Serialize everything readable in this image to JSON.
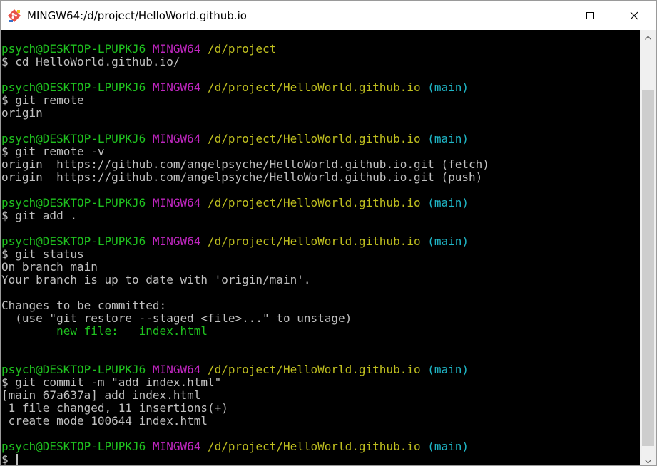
{
  "window": {
    "title": "MINGW64:/d/project/HelloWorld.github.io",
    "icons": {
      "app": "git-bash-icon",
      "minimize": "minimize-icon",
      "maximize": "maximize-icon",
      "close": "close-icon"
    }
  },
  "terminal": {
    "colors": {
      "background": "#000000",
      "text": "#c0c0c0",
      "user_host": "#1fc21f",
      "shell": "#c026c0",
      "path": "#bfbf1f",
      "branch": "#1fb6c6"
    },
    "lines": [
      [
        {
          "t": "psych@DESKTOP-LPUPKJ6 ",
          "c": "c-green"
        },
        {
          "t": "MINGW64 ",
          "c": "c-magenta"
        },
        {
          "t": "/d/project",
          "c": "c-yellow"
        }
      ],
      [
        {
          "t": "$ cd HelloWorld.github.io/",
          "c": "c-white"
        }
      ],
      [],
      [
        {
          "t": "psych@DESKTOP-LPUPKJ6 ",
          "c": "c-green"
        },
        {
          "t": "MINGW64 ",
          "c": "c-magenta"
        },
        {
          "t": "/d/project/HelloWorld.github.io",
          "c": "c-yellow"
        },
        {
          "t": " (main)",
          "c": "c-cyan"
        }
      ],
      [
        {
          "t": "$ git remote",
          "c": "c-white"
        }
      ],
      [
        {
          "t": "origin",
          "c": "c-white"
        }
      ],
      [],
      [
        {
          "t": "psych@DESKTOP-LPUPKJ6 ",
          "c": "c-green"
        },
        {
          "t": "MINGW64 ",
          "c": "c-magenta"
        },
        {
          "t": "/d/project/HelloWorld.github.io",
          "c": "c-yellow"
        },
        {
          "t": " (main)",
          "c": "c-cyan"
        }
      ],
      [
        {
          "t": "$ git remote -v",
          "c": "c-white"
        }
      ],
      [
        {
          "t": "origin  https://github.com/angelpsyche/HelloWorld.github.io.git (fetch)",
          "c": "c-white"
        }
      ],
      [
        {
          "t": "origin  https://github.com/angelpsyche/HelloWorld.github.io.git (push)",
          "c": "c-white"
        }
      ],
      [],
      [
        {
          "t": "psych@DESKTOP-LPUPKJ6 ",
          "c": "c-green"
        },
        {
          "t": "MINGW64 ",
          "c": "c-magenta"
        },
        {
          "t": "/d/project/HelloWorld.github.io",
          "c": "c-yellow"
        },
        {
          "t": " (main)",
          "c": "c-cyan"
        }
      ],
      [
        {
          "t": "$ git add .",
          "c": "c-white"
        }
      ],
      [],
      [
        {
          "t": "psych@DESKTOP-LPUPKJ6 ",
          "c": "c-green"
        },
        {
          "t": "MINGW64 ",
          "c": "c-magenta"
        },
        {
          "t": "/d/project/HelloWorld.github.io",
          "c": "c-yellow"
        },
        {
          "t": " (main)",
          "c": "c-cyan"
        }
      ],
      [
        {
          "t": "$ git status",
          "c": "c-white"
        }
      ],
      [
        {
          "t": "On branch main",
          "c": "c-white"
        }
      ],
      [
        {
          "t": "Your branch is up to date with 'origin/main'.",
          "c": "c-white"
        }
      ],
      [],
      [
        {
          "t": "Changes to be committed:",
          "c": "c-white"
        }
      ],
      [
        {
          "t": "  (use \"git restore --staged <file>...\" to unstage)",
          "c": "c-white"
        }
      ],
      [
        {
          "t": "        new file:   index.html",
          "c": "c-newfile"
        }
      ],
      [],
      [],
      [
        {
          "t": "psych@DESKTOP-LPUPKJ6 ",
          "c": "c-green"
        },
        {
          "t": "MINGW64 ",
          "c": "c-magenta"
        },
        {
          "t": "/d/project/HelloWorld.github.io",
          "c": "c-yellow"
        },
        {
          "t": " (main)",
          "c": "c-cyan"
        }
      ],
      [
        {
          "t": "$ git commit -m \"add index.html\"",
          "c": "c-white"
        }
      ],
      [
        {
          "t": "[main 67a637a] add index.html",
          "c": "c-white"
        }
      ],
      [
        {
          "t": " 1 file changed, 11 insertions(+)",
          "c": "c-white"
        }
      ],
      [
        {
          "t": " create mode 100644 index.html",
          "c": "c-white"
        }
      ],
      [],
      [
        {
          "t": "psych@DESKTOP-LPUPKJ6 ",
          "c": "c-green"
        },
        {
          "t": "MINGW64 ",
          "c": "c-magenta"
        },
        {
          "t": "/d/project/HelloWorld.github.io",
          "c": "c-yellow"
        },
        {
          "t": " (main)",
          "c": "c-cyan"
        }
      ],
      [
        {
          "t": "$ ",
          "c": "c-white"
        }
      ]
    ]
  },
  "scrollbar": {
    "up_icon": "scroll-up-arrow-icon",
    "down_icon": "scroll-down-arrow-icon"
  }
}
